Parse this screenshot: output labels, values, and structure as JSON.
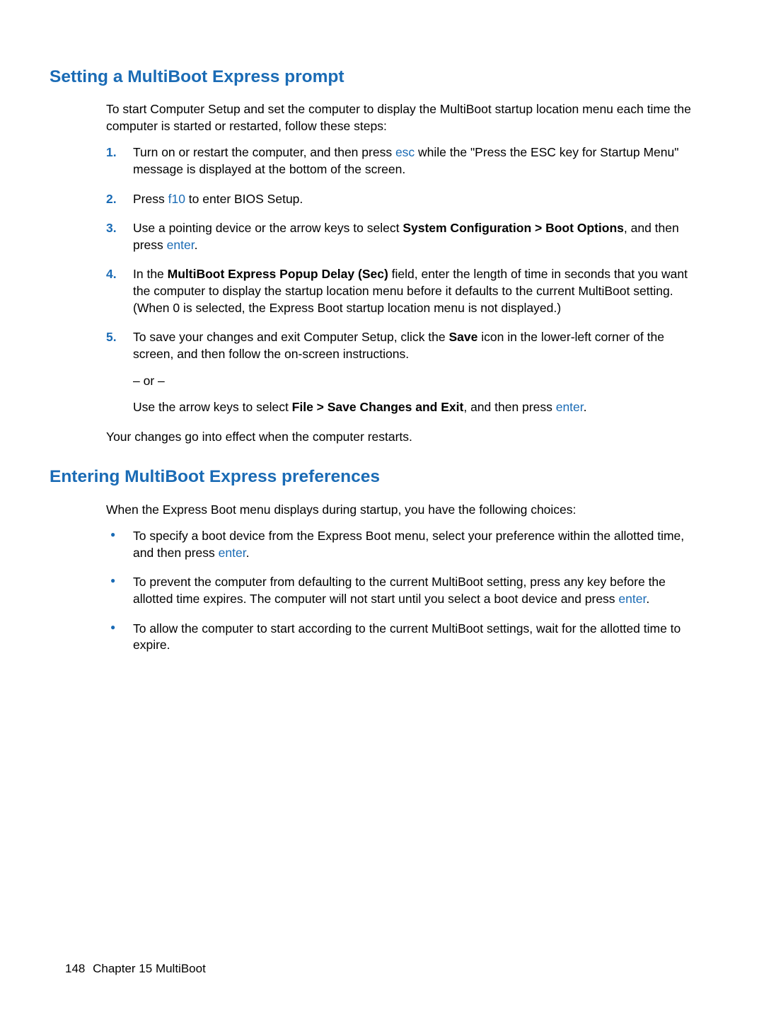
{
  "section1": {
    "heading": "Setting a MultiBoot Express prompt",
    "intro": "To start Computer Setup and set the computer to display the MultiBoot startup location menu each time the computer is started or restarted, follow these steps:",
    "items": [
      {
        "num": "1.",
        "t1": "Turn on or restart the computer, and then press ",
        "kw1": "esc",
        "t2": " while the \"Press the ESC key for Startup Menu\" message is displayed at the bottom of the screen."
      },
      {
        "num": "2.",
        "t1": "Press ",
        "kw1": "f10",
        "t2": " to enter BIOS Setup."
      },
      {
        "num": "3.",
        "t1": "Use a pointing device or the arrow keys to select ",
        "b1": "System Configuration > Boot Options",
        "t2": ", and then press ",
        "kw1": "enter",
        "t3": "."
      },
      {
        "num": "4.",
        "t1": "In the ",
        "b1": "MultiBoot Express Popup Delay (Sec)",
        "t2": " field, enter the length of time in seconds that you want the computer to display the startup location menu before it defaults to the current MultiBoot setting. (When 0 is selected, the Express Boot startup location menu is not displayed.)"
      },
      {
        "num": "5.",
        "t1": "To save your changes and exit Computer Setup, click the ",
        "b1": "Save",
        "t2": " icon in the lower-left corner of the screen, and then follow the on-screen instructions.",
        "or": "– or –",
        "sub_t1": "Use the arrow keys to select ",
        "sub_b1": "File > Save Changes and Exit",
        "sub_t2": ", and then press ",
        "sub_kw1": "enter",
        "sub_t3": "."
      }
    ],
    "after": "Your changes go into effect when the computer restarts."
  },
  "section2": {
    "heading": "Entering MultiBoot Express preferences",
    "intro": "When the Express Boot menu displays during startup, you have the following choices:",
    "bullets": [
      {
        "t1": "To specify a boot device from the Express Boot menu, select your preference within the allotted time, and then press ",
        "kw1": "enter",
        "t2": "."
      },
      {
        "t1": "To prevent the computer from defaulting to the current MultiBoot setting, press any key before the allotted time expires. The computer will not start until you select a boot device and press ",
        "kw1": "enter",
        "t2": "."
      },
      {
        "t1": "To allow the computer to start according to the current MultiBoot settings, wait for the allotted time to expire."
      }
    ]
  },
  "footer": {
    "page": "148",
    "chapter": "Chapter 15   MultiBoot"
  }
}
